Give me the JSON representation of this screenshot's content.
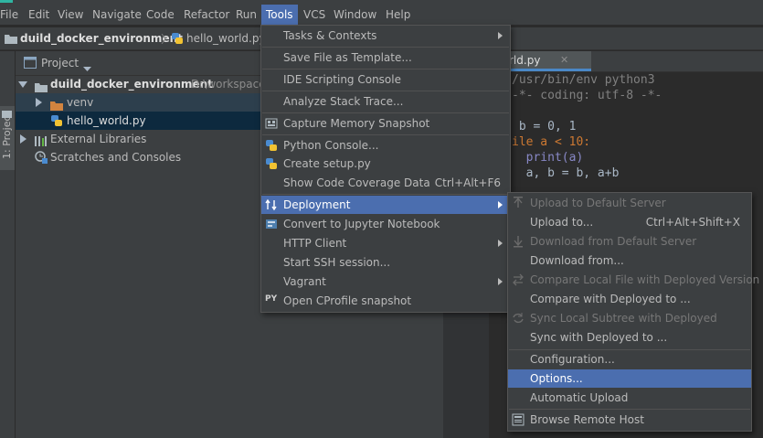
{
  "menubar": {
    "items": [
      "File",
      "Edit",
      "View",
      "Navigate",
      "Code",
      "Refactor",
      "Run",
      "Tools",
      "VCS",
      "Window",
      "Help"
    ],
    "active": "Tools"
  },
  "navbar": {
    "project": "duild_docker_environment",
    "file": "hello_world.py"
  },
  "sidestrip": {
    "label": "1: Project"
  },
  "project_panel": {
    "title": "Project",
    "root_name": "duild_docker_environment",
    "root_path": "D:\\workspace\\",
    "tree": [
      "venv",
      "hello_world.py",
      "External Libraries",
      "Scratches and Consoles"
    ]
  },
  "editor": {
    "tab": "rld.py",
    "lines": [
      "/usr/bin/env python3",
      "-*- coding: utf-8 -*-",
      "",
      " b = 0, 1",
      "ile a < 10:",
      "  print(a)",
      "  a, b = b, a+b"
    ]
  },
  "tools_menu": {
    "items": [
      {
        "label": "Tasks & Contexts",
        "submenu": true
      },
      {
        "label": "Save File as Template..."
      },
      {
        "label": "IDE Scripting Console"
      },
      {
        "label": "Analyze Stack Trace..."
      },
      {
        "label": "Capture Memory Snapshot"
      },
      {
        "label": "Python Console..."
      },
      {
        "label": "Create setup.py"
      },
      {
        "label": "Show Code Coverage Data",
        "shortcut": "Ctrl+Alt+F6"
      },
      {
        "label": "Deployment",
        "submenu": true
      },
      {
        "label": "Convert to Jupyter Notebook"
      },
      {
        "label": "HTTP Client",
        "submenu": true
      },
      {
        "label": "Start SSH session..."
      },
      {
        "label": "Vagrant",
        "submenu": true
      },
      {
        "label": "Open CProfile snapshot"
      }
    ]
  },
  "deployment_menu": {
    "items": [
      {
        "label": "Upload to Default Server",
        "disabled": true
      },
      {
        "label": "Upload to...",
        "shortcut": "Ctrl+Alt+Shift+X"
      },
      {
        "label": "Download from Default Server",
        "disabled": true
      },
      {
        "label": "Download from..."
      },
      {
        "label": "Compare Local File with Deployed Version",
        "disabled": true
      },
      {
        "label": "Compare with Deployed to ..."
      },
      {
        "label": "Sync Local Subtree with Deployed",
        "disabled": true
      },
      {
        "label": "Sync with Deployed to ..."
      },
      {
        "label": "Configuration..."
      },
      {
        "label": "Options..."
      },
      {
        "label": "Automatic Upload"
      },
      {
        "label": "Browse Remote Host"
      }
    ]
  },
  "colors": {
    "highlight": "#4b6eaf",
    "panel": "#3c3f41",
    "editor_bg": "#2b2b2b",
    "selection": "#0d293e"
  },
  "icons": [
    "project-folder-icon",
    "python-file-icon",
    "folder-icon",
    "library-icon",
    "scratches-icon",
    "deployment-icon",
    "jupyter-icon",
    "memory-icon",
    "python-icon",
    "upload-icon",
    "download-icon",
    "sync-icon",
    "browse-icon"
  ]
}
